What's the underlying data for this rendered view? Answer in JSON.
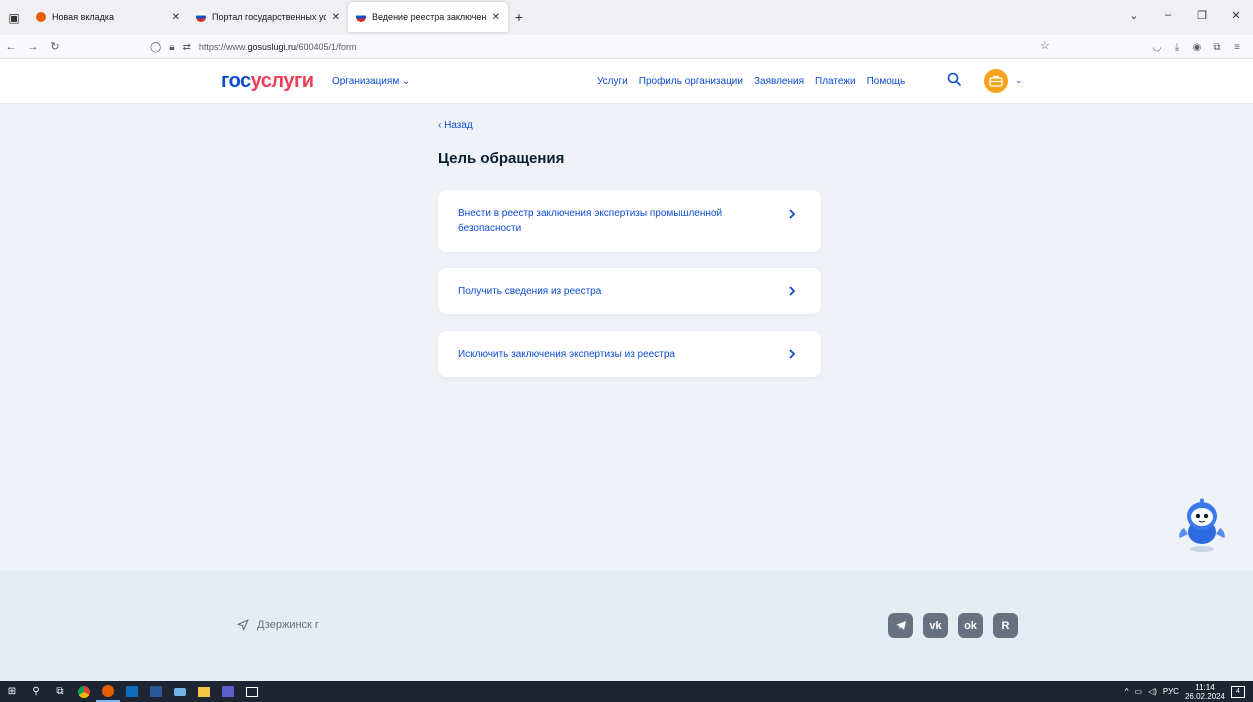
{
  "browser": {
    "tabs": [
      {
        "title": "Новая вкладка",
        "active": false,
        "favicon_color": "#e66000"
      },
      {
        "title": "Портал государственных усл",
        "active": false,
        "favicon_color": "#0d4cd3"
      },
      {
        "title": "Ведение реестра заключений",
        "active": true,
        "favicon_color": "#0d4cd3"
      }
    ],
    "url_prefix": "https://www.",
    "url_domain": "gosuslugi.ru",
    "url_path": "/600405/1/form"
  },
  "header": {
    "logo_part1": "гос",
    "logo_part2": "услуги",
    "org_menu": "Организациям",
    "menu": [
      "Услуги",
      "Профиль организации",
      "Заявления",
      "Платежи",
      "Помощь"
    ]
  },
  "main": {
    "back_label": "Назад",
    "title": "Цель обращения",
    "options": [
      {
        "line1": "Внести в реестр заключения экспертизы промышленной",
        "line2": "безопасности"
      },
      {
        "line1": "Получить сведения из реестра",
        "line2": ""
      },
      {
        "line1": "Исключить заключения экспертизы из реестра",
        "line2": ""
      }
    ]
  },
  "footer": {
    "location": "Дзержинск г",
    "socials": [
      "telegram",
      "vk",
      "ok",
      "rutube"
    ]
  },
  "taskbar": {
    "lang": "РУС",
    "time": "11:14",
    "date": "26.02.2024",
    "notifications": "4"
  },
  "colors": {
    "brand_blue": "#0d4cd3",
    "brand_red": "#ee3f58",
    "avatar_orange": "#f7a41b",
    "page_bg": "#eff3f8"
  }
}
